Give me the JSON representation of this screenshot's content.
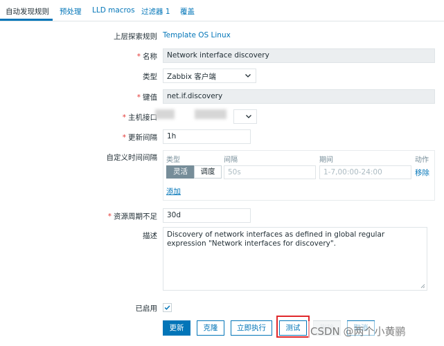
{
  "tabs": [
    {
      "label": "自动发现规则"
    },
    {
      "label": "预处理"
    },
    {
      "label": "LLD macros"
    },
    {
      "label": "过滤器 1"
    },
    {
      "label": "覆盖"
    }
  ],
  "form": {
    "parent_rule_label": "上层探索规则",
    "parent_rule_link": "Template OS Linux",
    "name_label": "名称",
    "name_value": "Network interface discovery",
    "type_label": "类型",
    "type_value": "Zabbix 客户端",
    "key_label": "键值",
    "key_value": "net.if.discovery",
    "host_interface_label": "主机接口",
    "update_interval_label": "更新间隔",
    "update_interval_value": "1h",
    "custom_intervals": {
      "label": "自定义时间间隔",
      "col_type": "类型",
      "col_interval": "间隔",
      "col_period": "期间",
      "col_action": "动作",
      "seg_flexible": "灵活",
      "seg_scheduling": "调度",
      "interval_placeholder": "50s",
      "period_placeholder": "1-7,00:00-24:00",
      "remove_link": "移除",
      "add_link": "添加"
    },
    "lifetime_label": "资源周期不足",
    "lifetime_value": "30d",
    "description_label": "描述",
    "description_value": "Discovery of network interfaces as defined in global regular expression \"Network interfaces for discovery\".",
    "enabled_label": "已启用",
    "enabled": true
  },
  "buttons": {
    "update": "更新",
    "clone": "克隆",
    "execute_now": "立即执行",
    "test": "测试",
    "delete": "删除",
    "cancel": "取消"
  },
  "watermark": "CSDN @两个小黄鹂",
  "colors": {
    "accent": "#0275b8",
    "required": "#e33734",
    "highlight_box": "#e0282b"
  }
}
